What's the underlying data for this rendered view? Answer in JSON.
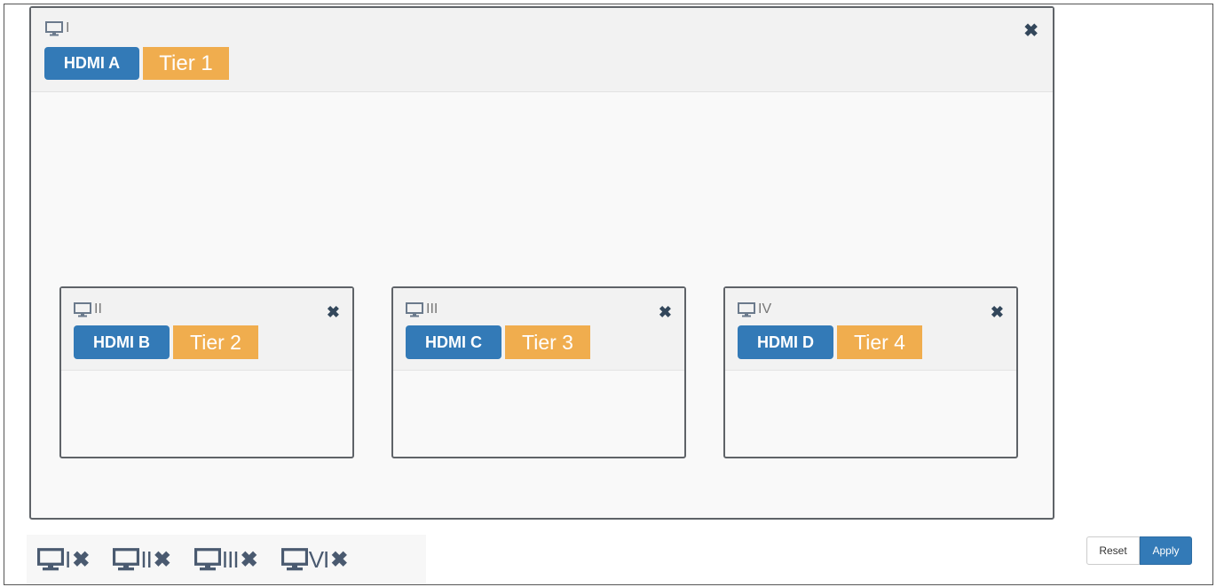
{
  "windows": [
    {
      "roman": "I",
      "source": "HDMI A",
      "tier": "Tier 1",
      "close": "✖"
    },
    {
      "roman": "II",
      "source": "HDMI B",
      "tier": "Tier 2",
      "close": "✖"
    },
    {
      "roman": "III",
      "source": "HDMI C",
      "tier": "Tier 3",
      "close": "✖"
    },
    {
      "roman": "IV",
      "source": "HDMI D",
      "tier": "Tier 4",
      "close": "✖"
    }
  ],
  "toggles": [
    {
      "roman": "I",
      "x": "✖"
    },
    {
      "roman": "II",
      "x": "✖"
    },
    {
      "roman": "III",
      "x": "✖"
    },
    {
      "roman": "VI",
      "x": "✖"
    }
  ],
  "buttons": {
    "reset": "Reset",
    "apply": "Apply"
  },
  "colors": {
    "hdmi_badge": "#337ab7",
    "tier_badge": "#f0ad4e",
    "apply_button": "#337ab7"
  },
  "icons": {
    "window": "monitor-icon",
    "close": "close-icon"
  }
}
